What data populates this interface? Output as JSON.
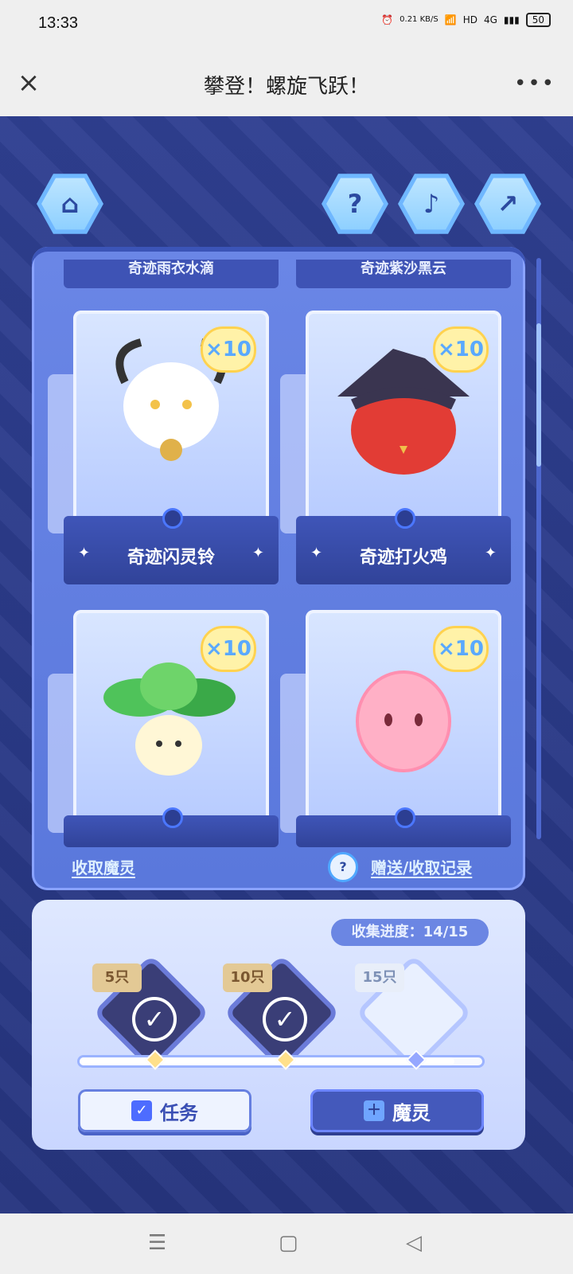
{
  "status": {
    "time": "13:33",
    "net_speed": "0.21\nKB/S",
    "hd_label": "HD",
    "network_label": "4G",
    "battery": "50"
  },
  "titlebar": {
    "title": "攀登！螺旋飞跃！"
  },
  "top_buttons": {
    "home_icon": "home-icon",
    "help_icon": "help-icon",
    "music_icon": "music-icon",
    "share_icon": "share-icon"
  },
  "gallery": {
    "top_strip_left": "奇迹雨衣水滴",
    "top_strip_right": "奇迹紫沙黑云",
    "cards": [
      {
        "name": "奇迹闪灵铃",
        "badge": "×10"
      },
      {
        "name": "奇迹打火鸡",
        "badge": "×10"
      },
      {
        "name": "",
        "badge": "×10"
      },
      {
        "name": "",
        "badge": "×10"
      }
    ],
    "collect_link": "收取魔灵",
    "record_link": "赠送/收取记录"
  },
  "progress": {
    "label": "收集进度：",
    "value": "14/15",
    "milestones": [
      {
        "tag": "5只",
        "state": "claimed"
      },
      {
        "tag": "10只",
        "state": "claimed"
      },
      {
        "tag": "15只",
        "state": "locked"
      }
    ],
    "fraction": 0.93
  },
  "buttons": {
    "task": "任务",
    "spirit": "魔灵"
  }
}
